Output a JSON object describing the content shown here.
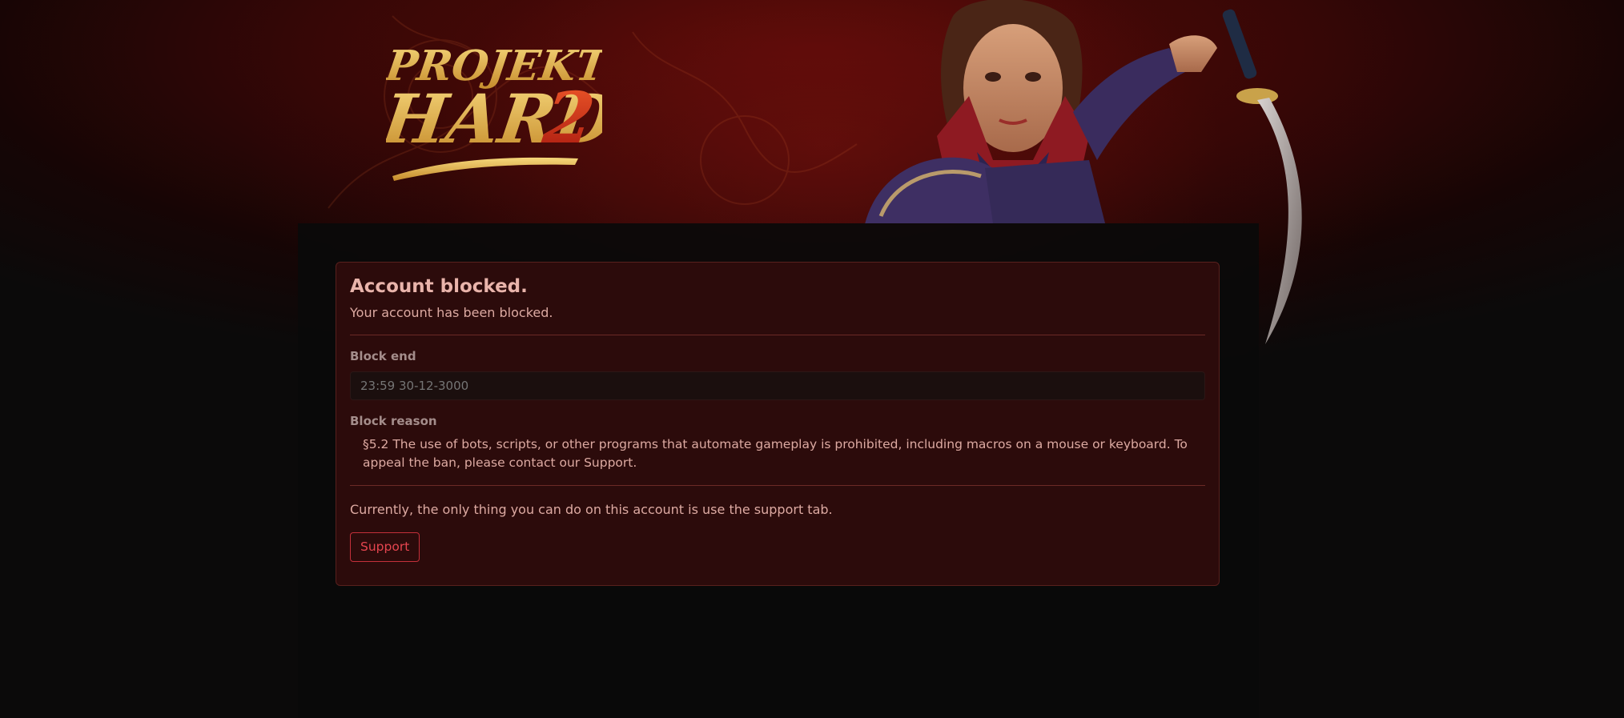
{
  "brand": {
    "logo_top": "PROJEKT",
    "logo_bottom": "HARD",
    "logo_number": "2",
    "colors": {
      "logo_gold": "#f0c35a",
      "logo_red": "#d8361f",
      "background_red": "#5a0a08",
      "panel": "#0a0a0a"
    }
  },
  "alert": {
    "title": "Account blocked.",
    "message": "Your account has been blocked.",
    "block_end_label": "Block end",
    "block_end_value": "23:59 30-12-3000",
    "block_reason_label": "Block reason",
    "block_reason_text": "§5.2 The use of bots, scripts, or other programs that automate gameplay is prohibited, including macros on a mouse or keyboard. To appeal the ban, please contact our Support.",
    "info": "Currently, the only thing you can do on this account is use the support tab.",
    "support_button": "Support",
    "colors": {
      "card_bg": "#2c0b0b",
      "card_border": "#58201d",
      "button_accent": "#c4303a"
    }
  }
}
